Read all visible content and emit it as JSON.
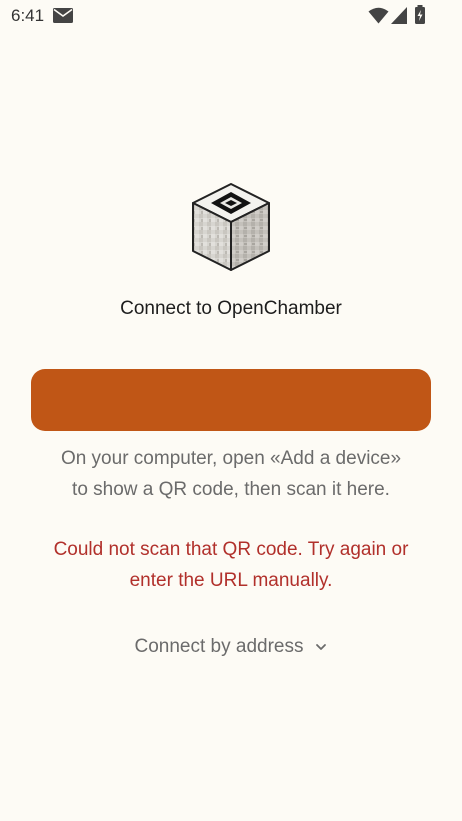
{
  "status_bar": {
    "time": "6:41",
    "icons": [
      "mail-icon",
      "wifi-icon",
      "signal-icon",
      "battery-icon"
    ]
  },
  "logo": {
    "icon": "openchamber-cube-icon"
  },
  "title": "Connect to OpenChamber",
  "scan_button": {
    "label": "",
    "color": "#c05616"
  },
  "instructions": {
    "line1": "On your computer, open «Add a device»",
    "line2": "to show a QR code, then scan it here."
  },
  "error": {
    "line1": "Could not scan that QR code. Try again or",
    "line2": "enter the URL manually.",
    "color": "#b1302b"
  },
  "connect_by_address": {
    "label": "Connect by address",
    "icon": "chevron-down-icon"
  },
  "colors": {
    "background": "#fdfbf5",
    "accent": "#c05616",
    "muted_text": "#6b6b6b"
  }
}
